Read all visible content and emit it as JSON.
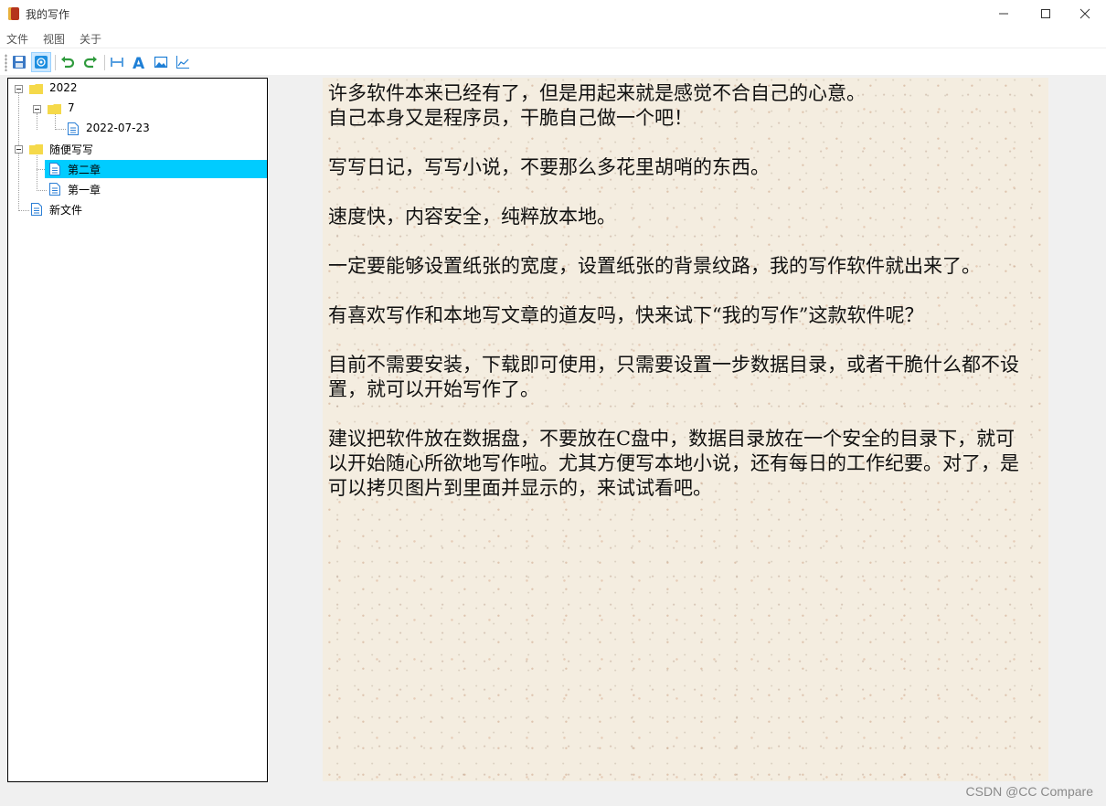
{
  "window": {
    "title": "我的写作"
  },
  "menu": {
    "items": [
      "文件",
      "视图",
      "关于"
    ]
  },
  "toolbar": {
    "buttons": [
      {
        "icon": "save-icon",
        "active": false
      },
      {
        "icon": "at-icon",
        "active": true
      },
      {
        "icon": "undo-icon",
        "active": false
      },
      {
        "icon": "redo-icon",
        "active": false
      },
      {
        "icon": "page-width-icon",
        "active": false
      },
      {
        "icon": "font-icon",
        "active": false
      },
      {
        "icon": "background-image-icon",
        "active": false
      },
      {
        "icon": "chart-icon",
        "active": false
      }
    ]
  },
  "tree": {
    "nodes": [
      {
        "label": "2022",
        "type": "folder",
        "level": 0,
        "expanded": true
      },
      {
        "label": "7",
        "type": "folder",
        "level": 1,
        "expanded": true
      },
      {
        "label": "2022-07-23",
        "type": "file",
        "level": 2
      },
      {
        "label": "随便写写",
        "type": "folder",
        "level": 0,
        "expanded": true
      },
      {
        "label": "第二章",
        "type": "file",
        "level": 1,
        "selected": true
      },
      {
        "label": "第一章",
        "type": "file",
        "level": 1
      },
      {
        "label": "新文件",
        "type": "file",
        "level": 0
      }
    ],
    "selected_color": "#00ccff"
  },
  "editor": {
    "paragraphs": [
      "许多软件本来已经有了，但是用起来就是感觉不合自己的心意。\n自己本身又是程序员，干脆自己做一个吧！",
      "写写日记，写写小说，不要那么多花里胡哨的东西。",
      "速度快，内容安全，纯粹放本地。",
      "一定要能够设置纸张的宽度，设置纸张的背景纹路，我的写作软件就出来了。",
      "有喜欢写作和本地写文章的道友吗，快来试下“我的写作”这款软件呢？",
      "目前不需要安装，下载即可使用，只需要设置一步数据目录，或者干脆什么都不设置，就可以开始写作了。",
      "建议把软件放在数据盘，不要放在C盘中，数据目录放在一个安全的目录下，就可以开始随心所欲地写作啦。尤其方便写本地小说，还有每日的工作纪要。对了，是可以拷贝图片到里面并显示的，来试试看吧。"
    ]
  },
  "watermark": "CSDN @CC Compare",
  "colors": {
    "paper": "#f4ede0",
    "folder": "#f5d94a",
    "file_icon": "#2b7fd6"
  }
}
